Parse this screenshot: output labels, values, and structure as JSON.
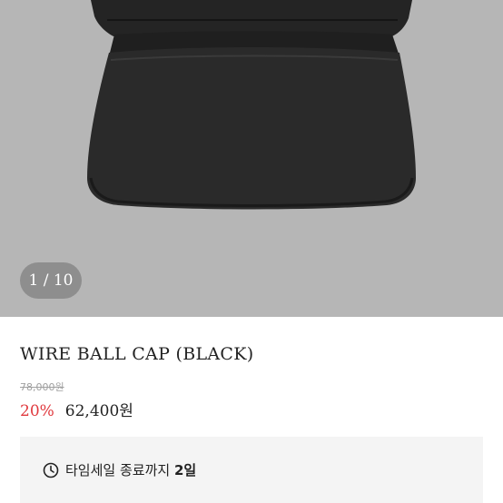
{
  "gallery": {
    "counter": "1 / 10",
    "image_alt": "black wire ball cap"
  },
  "product": {
    "name": "WIRE BALL CAP (BLACK)",
    "original_price": "78,000원",
    "discount": "20%",
    "price": "62,400원"
  },
  "timesale": {
    "icon": "clock-icon",
    "label": "타임세일 종료까지",
    "remaining": "2일"
  },
  "colors": {
    "discount": "#e0393e",
    "hero_background": "#b6b6b6"
  }
}
